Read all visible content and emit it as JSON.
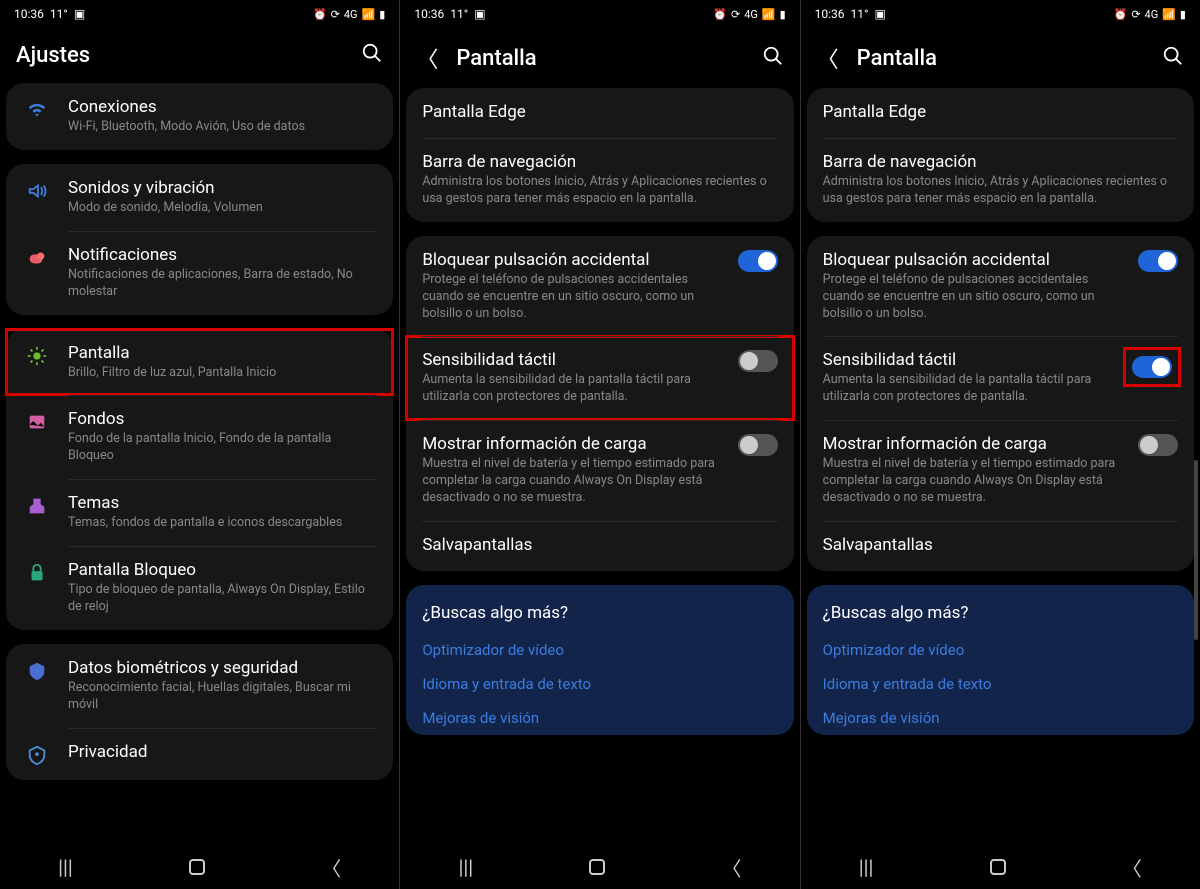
{
  "status": {
    "time": "10:36",
    "temp": "11°",
    "net": "4G"
  },
  "screen1": {
    "title": "Ajustes",
    "groups": [
      [
        {
          "icon": "wifi",
          "label": "Conexiones",
          "desc": "Wi-Fi, Bluetooth, Modo Avión, Uso de datos"
        }
      ],
      [
        {
          "icon": "sound",
          "label": "Sonidos y vibración",
          "desc": "Modo de sonido, Melodía, Volumen"
        },
        {
          "icon": "notif",
          "label": "Notificaciones",
          "desc": "Notificaciones de aplicaciones, Barra de estado, No molestar"
        }
      ],
      [
        {
          "icon": "display",
          "label": "Pantalla",
          "desc": "Brillo, Filtro de luz azul, Pantalla Inicio",
          "hl": true
        },
        {
          "icon": "wall",
          "label": "Fondos",
          "desc": "Fondo de la pantalla Inicio, Fondo de la pantalla Bloqueo"
        },
        {
          "icon": "theme",
          "label": "Temas",
          "desc": "Temas, fondos de pantalla e iconos descargables"
        },
        {
          "icon": "lock",
          "label": "Pantalla Bloqueo",
          "desc": "Tipo de bloqueo de pantalla, Always On Display, Estilo de reloj"
        }
      ],
      [
        {
          "icon": "bio",
          "label": "Datos biométricos y seguridad",
          "desc": "Reconocimiento facial, Huellas digitales, Buscar mi móvil"
        },
        {
          "icon": "priv",
          "label": "Privacidad",
          "desc": ""
        }
      ]
    ]
  },
  "screen2": {
    "title": "Pantalla",
    "top": [
      {
        "label": "Pantalla Edge",
        "desc": ""
      },
      {
        "label": "Barra de navegación",
        "desc": "Administra los botones Inicio, Atrás y Aplicaciones recientes o usa gestos para tener más espacio en la pantalla."
      }
    ],
    "mid": [
      {
        "label": "Bloquear pulsación accidental",
        "desc": "Protege el teléfono de pulsaciones accidentales cuando se encuentre en un sitio oscuro, como un bolsillo o un bolso.",
        "toggle": "on"
      },
      {
        "label": "Sensibilidad táctil",
        "desc": "Aumenta la sensibilidad de la pantalla táctil para utilizarla con protectores de pantalla.",
        "toggle": "off",
        "hl": true
      },
      {
        "label": "Mostrar información de carga",
        "desc": "Muestra el nivel de batería y el tiempo estimado para completar la carga cuando Always On Display está desactivado o no se muestra.",
        "toggle": "off"
      },
      {
        "label": "Salvapantallas",
        "desc": ""
      }
    ],
    "more_title": "¿Buscas algo más?",
    "more": [
      "Optimizador de vídeo",
      "Idioma y entrada de texto",
      "Mejoras de visión"
    ]
  },
  "screen3": {
    "title": "Pantalla",
    "top": [
      {
        "label": "Pantalla Edge",
        "desc": ""
      },
      {
        "label": "Barra de navegación",
        "desc": "Administra los botones Inicio, Atrás y Aplicaciones recientes o usa gestos para tener más espacio en la pantalla."
      }
    ],
    "mid": [
      {
        "label": "Bloquear pulsación accidental",
        "desc": "Protege el teléfono de pulsaciones accidentales cuando se encuentre en un sitio oscuro, como un bolsillo o un bolso.",
        "toggle": "on"
      },
      {
        "label": "Sensibilidad táctil",
        "desc": "Aumenta la sensibilidad de la pantalla táctil para utilizarla con protectores de pantalla.",
        "toggle": "on",
        "hl_toggle": true
      },
      {
        "label": "Mostrar información de carga",
        "desc": "Muestra el nivel de batería y el tiempo estimado para completar la carga cuando Always On Display está desactivado o no se muestra.",
        "toggle": "off"
      },
      {
        "label": "Salvapantallas",
        "desc": ""
      }
    ],
    "more_title": "¿Buscas algo más?",
    "more": [
      "Optimizador de vídeo",
      "Idioma y entrada de texto",
      "Mejoras de visión"
    ]
  }
}
